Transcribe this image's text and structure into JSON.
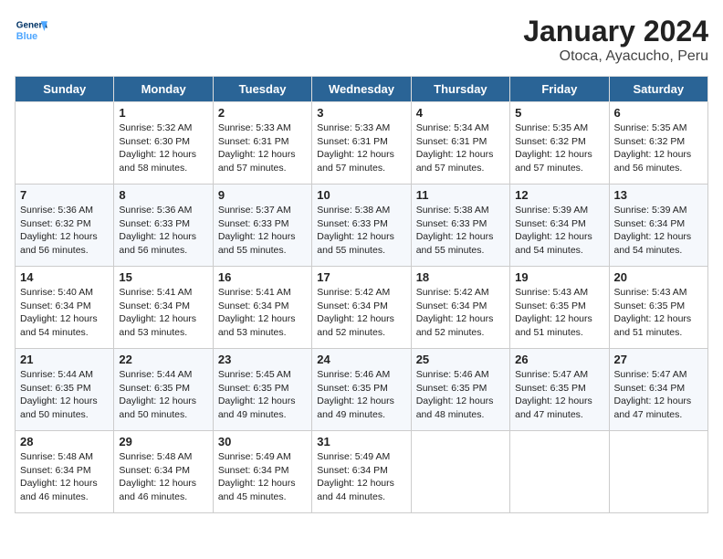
{
  "header": {
    "logo_general": "General",
    "logo_blue": "Blue",
    "title": "January 2024",
    "location": "Otoca, Ayacucho, Peru"
  },
  "days_of_week": [
    "Sunday",
    "Monday",
    "Tuesday",
    "Wednesday",
    "Thursday",
    "Friday",
    "Saturday"
  ],
  "weeks": [
    [
      {
        "day": "",
        "sunrise": "",
        "sunset": "",
        "daylight": ""
      },
      {
        "day": "1",
        "sunrise": "Sunrise: 5:32 AM",
        "sunset": "Sunset: 6:30 PM",
        "daylight": "Daylight: 12 hours and 58 minutes."
      },
      {
        "day": "2",
        "sunrise": "Sunrise: 5:33 AM",
        "sunset": "Sunset: 6:31 PM",
        "daylight": "Daylight: 12 hours and 57 minutes."
      },
      {
        "day": "3",
        "sunrise": "Sunrise: 5:33 AM",
        "sunset": "Sunset: 6:31 PM",
        "daylight": "Daylight: 12 hours and 57 minutes."
      },
      {
        "day": "4",
        "sunrise": "Sunrise: 5:34 AM",
        "sunset": "Sunset: 6:31 PM",
        "daylight": "Daylight: 12 hours and 57 minutes."
      },
      {
        "day": "5",
        "sunrise": "Sunrise: 5:35 AM",
        "sunset": "Sunset: 6:32 PM",
        "daylight": "Daylight: 12 hours and 57 minutes."
      },
      {
        "day": "6",
        "sunrise": "Sunrise: 5:35 AM",
        "sunset": "Sunset: 6:32 PM",
        "daylight": "Daylight: 12 hours and 56 minutes."
      }
    ],
    [
      {
        "day": "7",
        "sunrise": "Sunrise: 5:36 AM",
        "sunset": "Sunset: 6:32 PM",
        "daylight": "Daylight: 12 hours and 56 minutes."
      },
      {
        "day": "8",
        "sunrise": "Sunrise: 5:36 AM",
        "sunset": "Sunset: 6:33 PM",
        "daylight": "Daylight: 12 hours and 56 minutes."
      },
      {
        "day": "9",
        "sunrise": "Sunrise: 5:37 AM",
        "sunset": "Sunset: 6:33 PM",
        "daylight": "Daylight: 12 hours and 55 minutes."
      },
      {
        "day": "10",
        "sunrise": "Sunrise: 5:38 AM",
        "sunset": "Sunset: 6:33 PM",
        "daylight": "Daylight: 12 hours and 55 minutes."
      },
      {
        "day": "11",
        "sunrise": "Sunrise: 5:38 AM",
        "sunset": "Sunset: 6:33 PM",
        "daylight": "Daylight: 12 hours and 55 minutes."
      },
      {
        "day": "12",
        "sunrise": "Sunrise: 5:39 AM",
        "sunset": "Sunset: 6:34 PM",
        "daylight": "Daylight: 12 hours and 54 minutes."
      },
      {
        "day": "13",
        "sunrise": "Sunrise: 5:39 AM",
        "sunset": "Sunset: 6:34 PM",
        "daylight": "Daylight: 12 hours and 54 minutes."
      }
    ],
    [
      {
        "day": "14",
        "sunrise": "Sunrise: 5:40 AM",
        "sunset": "Sunset: 6:34 PM",
        "daylight": "Daylight: 12 hours and 54 minutes."
      },
      {
        "day": "15",
        "sunrise": "Sunrise: 5:41 AM",
        "sunset": "Sunset: 6:34 PM",
        "daylight": "Daylight: 12 hours and 53 minutes."
      },
      {
        "day": "16",
        "sunrise": "Sunrise: 5:41 AM",
        "sunset": "Sunset: 6:34 PM",
        "daylight": "Daylight: 12 hours and 53 minutes."
      },
      {
        "day": "17",
        "sunrise": "Sunrise: 5:42 AM",
        "sunset": "Sunset: 6:34 PM",
        "daylight": "Daylight: 12 hours and 52 minutes."
      },
      {
        "day": "18",
        "sunrise": "Sunrise: 5:42 AM",
        "sunset": "Sunset: 6:34 PM",
        "daylight": "Daylight: 12 hours and 52 minutes."
      },
      {
        "day": "19",
        "sunrise": "Sunrise: 5:43 AM",
        "sunset": "Sunset: 6:35 PM",
        "daylight": "Daylight: 12 hours and 51 minutes."
      },
      {
        "day": "20",
        "sunrise": "Sunrise: 5:43 AM",
        "sunset": "Sunset: 6:35 PM",
        "daylight": "Daylight: 12 hours and 51 minutes."
      }
    ],
    [
      {
        "day": "21",
        "sunrise": "Sunrise: 5:44 AM",
        "sunset": "Sunset: 6:35 PM",
        "daylight": "Daylight: 12 hours and 50 minutes."
      },
      {
        "day": "22",
        "sunrise": "Sunrise: 5:44 AM",
        "sunset": "Sunset: 6:35 PM",
        "daylight": "Daylight: 12 hours and 50 minutes."
      },
      {
        "day": "23",
        "sunrise": "Sunrise: 5:45 AM",
        "sunset": "Sunset: 6:35 PM",
        "daylight": "Daylight: 12 hours and 49 minutes."
      },
      {
        "day": "24",
        "sunrise": "Sunrise: 5:46 AM",
        "sunset": "Sunset: 6:35 PM",
        "daylight": "Daylight: 12 hours and 49 minutes."
      },
      {
        "day": "25",
        "sunrise": "Sunrise: 5:46 AM",
        "sunset": "Sunset: 6:35 PM",
        "daylight": "Daylight: 12 hours and 48 minutes."
      },
      {
        "day": "26",
        "sunrise": "Sunrise: 5:47 AM",
        "sunset": "Sunset: 6:35 PM",
        "daylight": "Daylight: 12 hours and 47 minutes."
      },
      {
        "day": "27",
        "sunrise": "Sunrise: 5:47 AM",
        "sunset": "Sunset: 6:34 PM",
        "daylight": "Daylight: 12 hours and 47 minutes."
      }
    ],
    [
      {
        "day": "28",
        "sunrise": "Sunrise: 5:48 AM",
        "sunset": "Sunset: 6:34 PM",
        "daylight": "Daylight: 12 hours and 46 minutes."
      },
      {
        "day": "29",
        "sunrise": "Sunrise: 5:48 AM",
        "sunset": "Sunset: 6:34 PM",
        "daylight": "Daylight: 12 hours and 46 minutes."
      },
      {
        "day": "30",
        "sunrise": "Sunrise: 5:49 AM",
        "sunset": "Sunset: 6:34 PM",
        "daylight": "Daylight: 12 hours and 45 minutes."
      },
      {
        "day": "31",
        "sunrise": "Sunrise: 5:49 AM",
        "sunset": "Sunset: 6:34 PM",
        "daylight": "Daylight: 12 hours and 44 minutes."
      },
      {
        "day": "",
        "sunrise": "",
        "sunset": "",
        "daylight": ""
      },
      {
        "day": "",
        "sunrise": "",
        "sunset": "",
        "daylight": ""
      },
      {
        "day": "",
        "sunrise": "",
        "sunset": "",
        "daylight": ""
      }
    ]
  ]
}
